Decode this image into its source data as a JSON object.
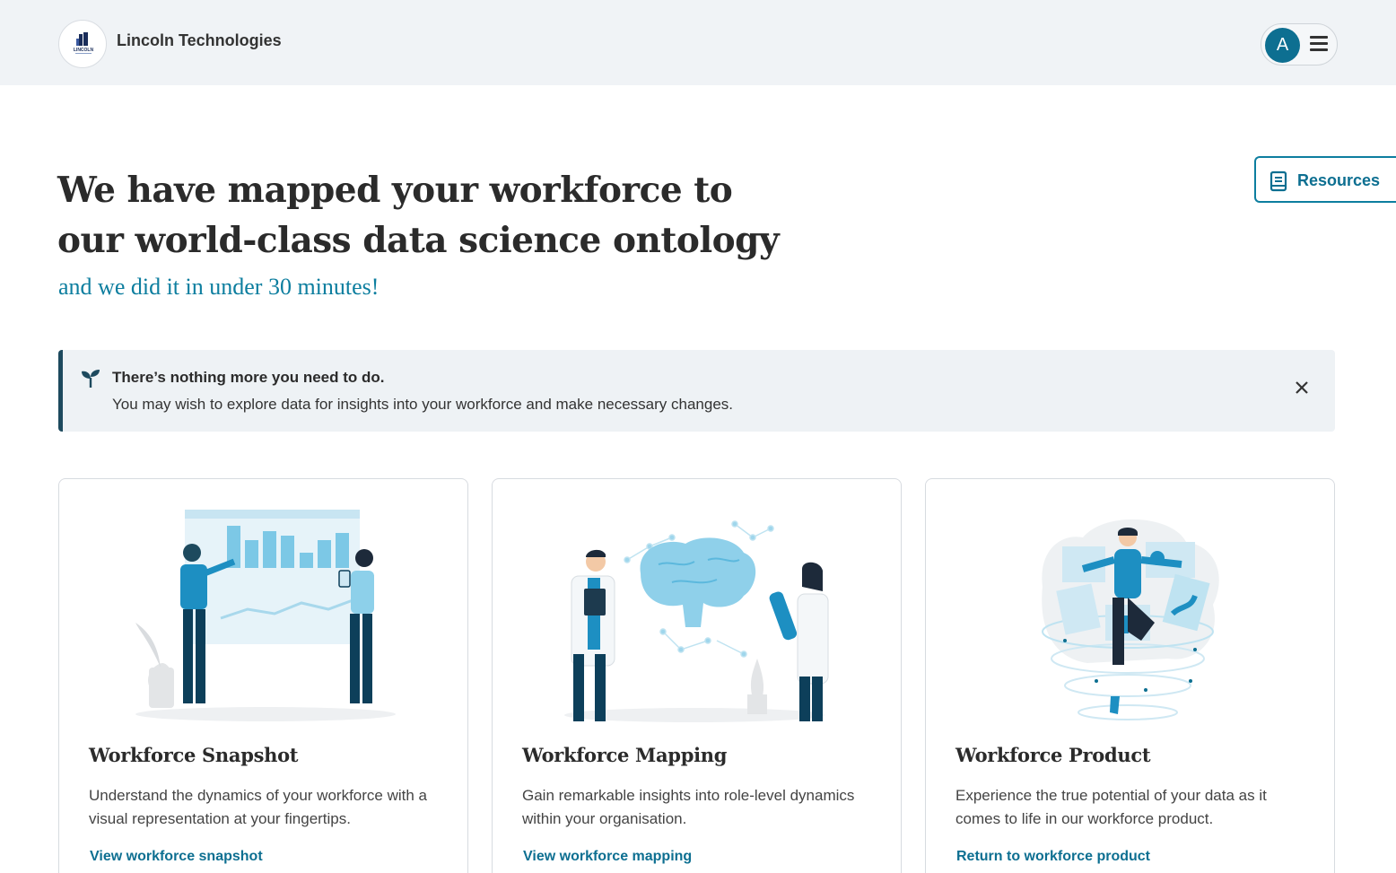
{
  "header": {
    "company_name": "Lincoln Technologies",
    "logo_text": "LINCOLN",
    "avatar_initial": "A"
  },
  "hero": {
    "title_line1": "We have mapped your workforce to",
    "title_line2": "our world-class data science ontology",
    "subtitle": "and we did it in under 30 minutes!"
  },
  "resources_button": {
    "label": "Resources",
    "icon": "book-icon"
  },
  "notice": {
    "icon": "sprout-icon",
    "title": "There’s nothing more you need to do.",
    "body": "You may wish to explore data for insights into your workforce and make necessary changes."
  },
  "cards": [
    {
      "title": "Workforce Snapshot",
      "description": "Understand the dynamics of your workforce with a visual representation at your fingertips.",
      "link": "View workforce snapshot"
    },
    {
      "title": "Workforce Mapping",
      "description": "Gain remarkable insights into role-level dynamics within your organisation.",
      "link": "View workforce mapping"
    },
    {
      "title": "Workforce Product",
      "description": "Experience the true potential of your data as it comes to life in our workforce product.",
      "link": "Return to workforce product"
    }
  ],
  "colors": {
    "accent": "#0d7e9f",
    "accent_dark": "#0d6f91",
    "notice_bg": "#eef2f5",
    "notice_border": "#1d4a5e",
    "header_bg": "#f0f3f6"
  }
}
